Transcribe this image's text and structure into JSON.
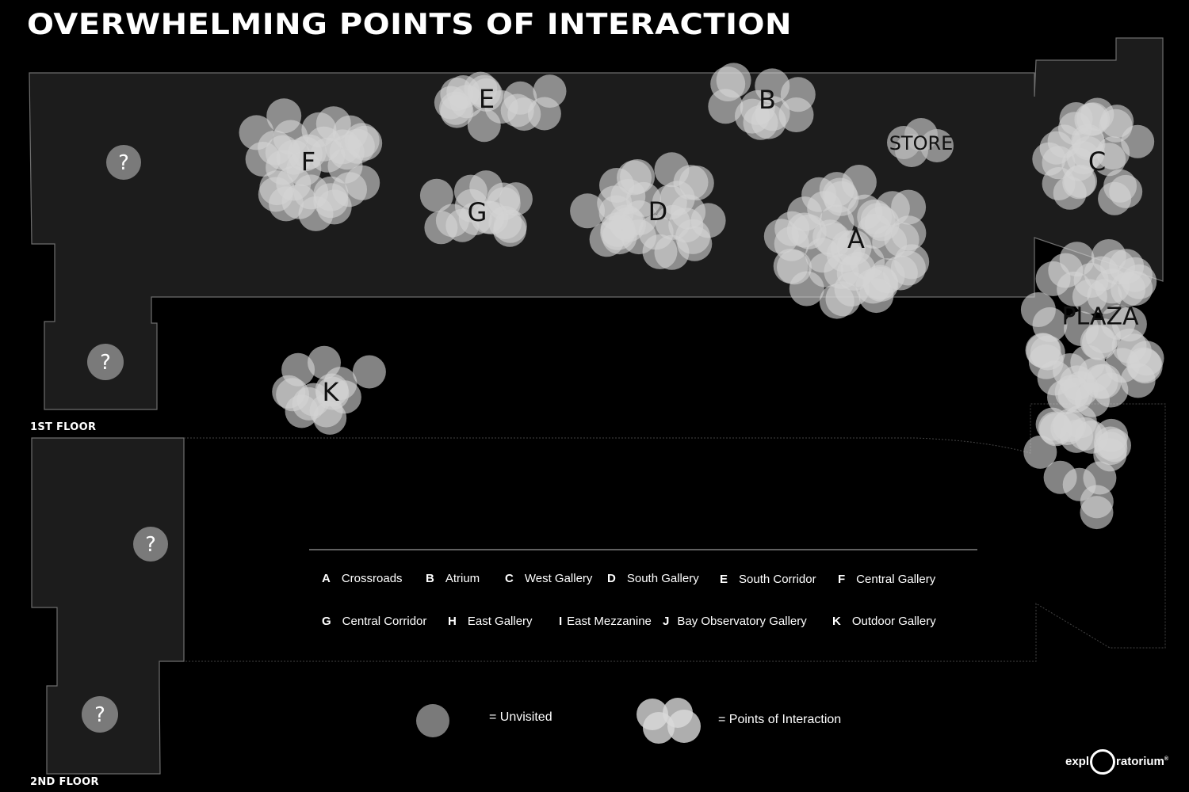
{
  "title": "OVERWHELMING POINTS OF INTERACTION",
  "floors": {
    "first": "1ST FLOOR",
    "second": "2ND FLOOR"
  },
  "unvisited_marker": "?",
  "zone_labels": {
    "A": "A",
    "B": "B",
    "C": "C",
    "D": "D",
    "E": "E",
    "F": "F",
    "G": "G",
    "K": "K",
    "store": "STORE",
    "plaza": "PLAZA"
  },
  "gallery_key": [
    {
      "letter": "A",
      "name": "Crossroads"
    },
    {
      "letter": "B",
      "name": "Atrium"
    },
    {
      "letter": "C",
      "name": "West Gallery"
    },
    {
      "letter": "D",
      "name": "South Gallery"
    },
    {
      "letter": "E",
      "name": "South Corridor"
    },
    {
      "letter": "F",
      "name": "Central Gallery"
    },
    {
      "letter": "G",
      "name": "Central Corridor"
    },
    {
      "letter": "H",
      "name": "East Gallery"
    },
    {
      "letter": "I",
      "name": "East Mezzanine"
    },
    {
      "letter": "J",
      "name": "Bay Observatory Gallery"
    },
    {
      "letter": "K",
      "name": "Outdoor Gallery"
    }
  ],
  "symbol_key": {
    "unvisited": "= Unvisited",
    "points": "= Points of Interaction"
  },
  "brand": {
    "left": "expl",
    "right": "ratorium"
  },
  "colors": {
    "floor": "#1c1c1c",
    "outline": "#777777",
    "bubble": "#d9d9d9",
    "unvisited": "#7a7a7a"
  }
}
